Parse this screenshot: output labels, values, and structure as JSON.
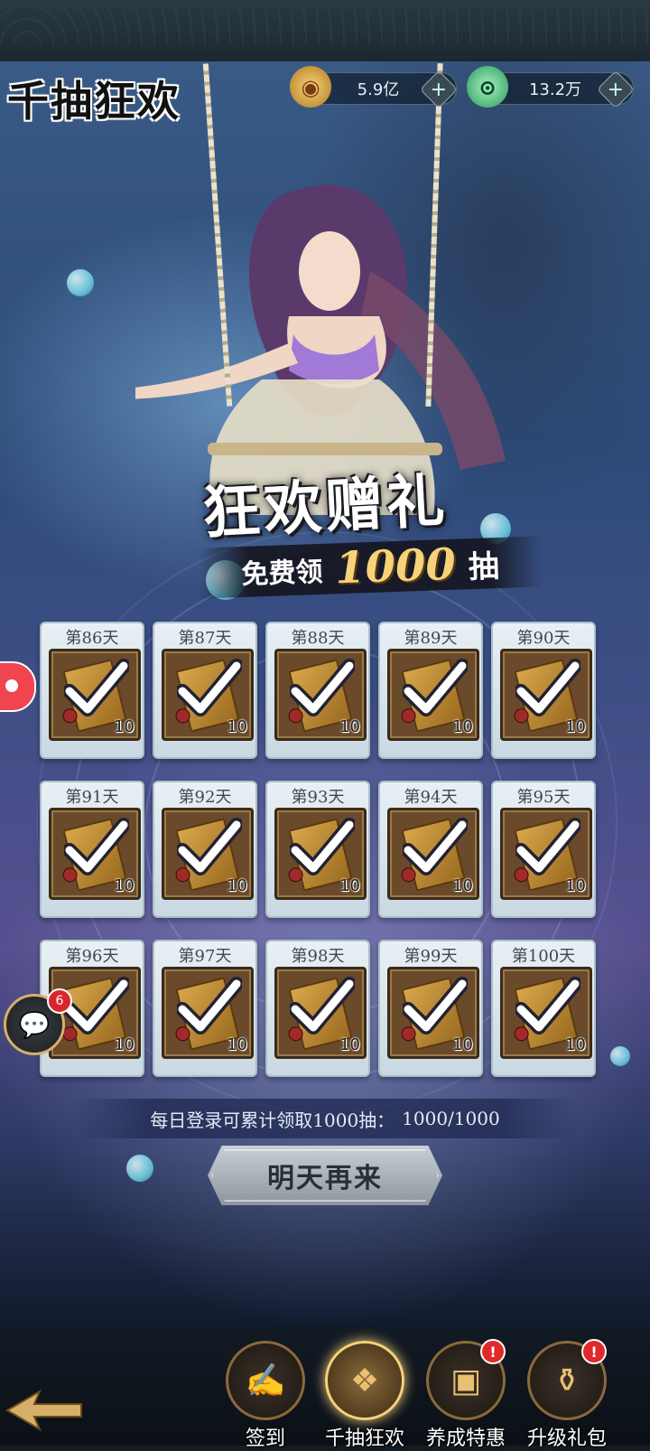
{
  "header": {
    "title": "千抽狂欢",
    "currencies": [
      {
        "icon": "copper-coin-icon",
        "value": "5.9亿",
        "plus": "+"
      },
      {
        "icon": "jade-icon",
        "value": "13.2万",
        "plus": "+"
      }
    ]
  },
  "banner": {
    "headline": "狂欢赠礼",
    "sub_prefix": "免费领",
    "sub_number": "1000",
    "sub_unit": "抽"
  },
  "days": [
    {
      "label": "第86天",
      "qty": "10",
      "claimed": true
    },
    {
      "label": "第87天",
      "qty": "10",
      "claimed": true
    },
    {
      "label": "第88天",
      "qty": "10",
      "claimed": true
    },
    {
      "label": "第89天",
      "qty": "10",
      "claimed": true
    },
    {
      "label": "第90天",
      "qty": "10",
      "claimed": true
    },
    {
      "label": "第91天",
      "qty": "10",
      "claimed": true
    },
    {
      "label": "第92天",
      "qty": "10",
      "claimed": true
    },
    {
      "label": "第93天",
      "qty": "10",
      "claimed": true
    },
    {
      "label": "第94天",
      "qty": "10",
      "claimed": true
    },
    {
      "label": "第95天",
      "qty": "10",
      "claimed": true
    },
    {
      "label": "第96天",
      "qty": "10",
      "claimed": true
    },
    {
      "label": "第97天",
      "qty": "10",
      "claimed": true
    },
    {
      "label": "第98天",
      "qty": "10",
      "claimed": true
    },
    {
      "label": "第99天",
      "qty": "10",
      "claimed": true
    },
    {
      "label": "第100天",
      "qty": "10",
      "claimed": true
    }
  ],
  "progress": {
    "label": "每日登录可累计领取1000抽：",
    "value": "1000/1000"
  },
  "action_button": "明天再来",
  "chat": {
    "badge": "6"
  },
  "nav": [
    {
      "label": "签到",
      "icon": "scroll-icon",
      "badge": ""
    },
    {
      "label": "千抽狂欢",
      "icon": "treasure-icon",
      "badge": "",
      "active": true
    },
    {
      "label": "养成特惠",
      "icon": "chest-icon",
      "badge": "!"
    },
    {
      "label": "升级礼包",
      "icon": "cauldron-icon",
      "badge": "!"
    }
  ],
  "colors": {
    "accent_gold": "#f6d27a",
    "badge_red": "#d8262c",
    "card_bg": "#e8f0f4"
  }
}
